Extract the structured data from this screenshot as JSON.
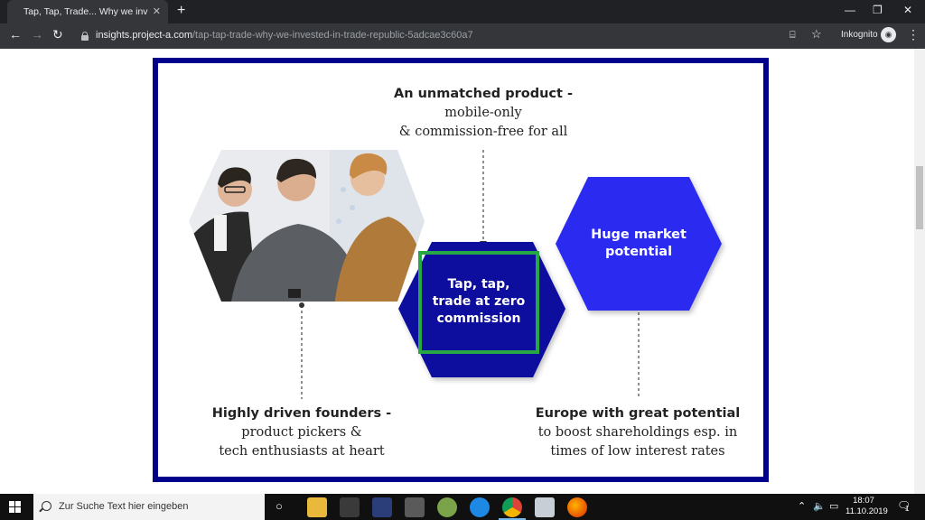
{
  "browser": {
    "tab_title": "Tap, Tap, Trade... Why we investe",
    "url_host": "insights.project-a.com",
    "url_path": "/tap-tap-trade-why-we-invested-in-trade-republic-5adcae3c60a7",
    "incognito_label": "Inkognito"
  },
  "diagram": {
    "top_label": {
      "heading": "An unmatched product -",
      "lines": [
        "mobile-only",
        "& commission-free for all"
      ]
    },
    "center_hex": [
      "Tap, tap,",
      "trade at zero",
      "commission"
    ],
    "right_hex": [
      "Huge market",
      "potential"
    ],
    "left_label": {
      "heading": "Highly driven founders -",
      "lines": [
        "product pickers &",
        "tech enthusiasts at heart"
      ]
    },
    "right_label": {
      "heading": "Europe with great potential",
      "lines": [
        "to boost shareholdings esp. in",
        "times of low interest rates"
      ]
    },
    "colors": {
      "frame": "#00008b",
      "center_hex": "#0a0a9e",
      "right_hex": "#2b2bf0",
      "highlight": "#27a844"
    }
  },
  "taskbar": {
    "search_placeholder": "Zur Suche Text hier eingeben",
    "time": "18:07",
    "date": "11.10.2019",
    "notification_count": "1"
  }
}
